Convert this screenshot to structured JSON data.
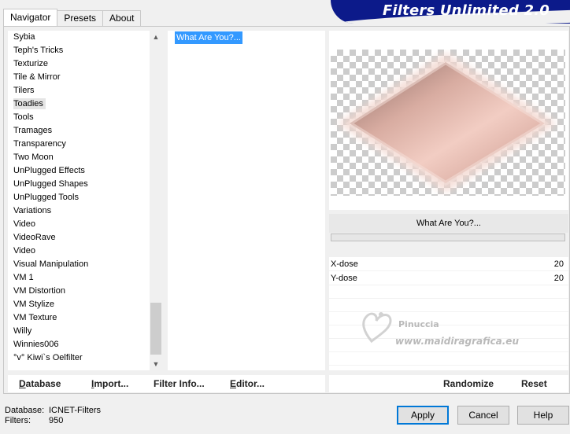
{
  "tabs": [
    "Navigator",
    "Presets",
    "About"
  ],
  "banner": {
    "title": "Filters Unlimited 2.0"
  },
  "categories": [
    "Sybia",
    "Teph's Tricks",
    "Texturize",
    "Tile & Mirror",
    "Tilers",
    "Toadies",
    "Tools",
    "Tramages",
    "Transparency",
    "Two Moon",
    "UnPlugged Effects",
    "UnPlugged Shapes",
    "UnPlugged Tools",
    "Variations",
    "Video",
    "VideoRave",
    "Video",
    "Visual Manipulation",
    "VM 1",
    "VM Distortion",
    "VM Stylize",
    "VM Texture",
    "Willy",
    "Winnies006",
    "°v° Kiwi`s Oelfilter"
  ],
  "selected_category": "Toadies",
  "filters": [
    "What Are You?..."
  ],
  "selected_filter_name": "What Are You?...",
  "params": [
    {
      "label": "X-dose",
      "value": "20"
    },
    {
      "label": "Y-dose",
      "value": "20"
    }
  ],
  "watermark": {
    "name": "Pinuccia",
    "url": "www.maidiragrafica.eu"
  },
  "left_actions": {
    "database": "Database",
    "import": "Import...",
    "filter_info": "Filter Info...",
    "editor": "Editor..."
  },
  "right_actions": {
    "randomize": "Randomize",
    "reset": "Reset"
  },
  "status": {
    "database_label": "Database:",
    "database_value": "ICNET-Filters",
    "filters_label": "Filters:",
    "filters_value": "950"
  },
  "dialog_buttons": {
    "apply": "Apply",
    "cancel": "Cancel",
    "help": "Help"
  },
  "icons": {
    "scroll_up": "chevron-up-icon",
    "scroll_down": "chevron-down-icon"
  },
  "colors": {
    "banner": "#0c1a8a",
    "selection": "#3399ff",
    "default_button_border": "#0078d7"
  }
}
